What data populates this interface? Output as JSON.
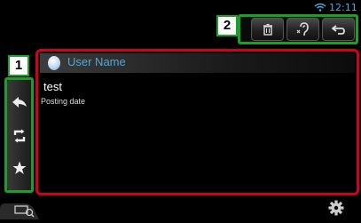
{
  "status_bar": {
    "time": "12:11"
  },
  "callouts": {
    "top": "2",
    "left": "1"
  },
  "toolbar": {
    "buttons": [
      {
        "icon": "trash-icon"
      },
      {
        "icon": "reply-voice-icon"
      },
      {
        "icon": "back-icon"
      }
    ]
  },
  "sidebar": {
    "buttons": [
      {
        "icon": "reply-icon"
      },
      {
        "icon": "retweet-icon"
      },
      {
        "icon": "favorite-star-icon"
      }
    ]
  },
  "post": {
    "user_name": "User Name",
    "text": "test",
    "date_label": "Posting date"
  },
  "colors": {
    "callout_border": "#1aa02a",
    "panel_border": "#d0021b",
    "accent": "#4fa8d8"
  }
}
